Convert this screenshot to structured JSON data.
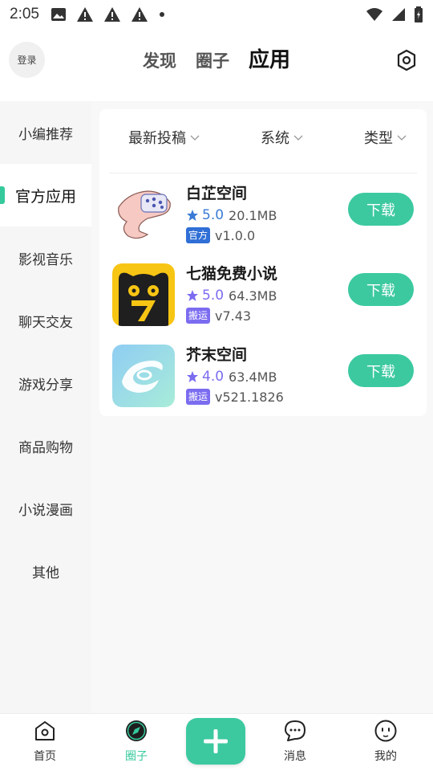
{
  "status_bar": {
    "time": "2:05",
    "left_icons": [
      "image-icon",
      "warning-icon",
      "warning-icon",
      "warning-icon",
      "dot-icon"
    ],
    "right_icons": [
      "wifi-icon",
      "signal-icon",
      "battery-icon"
    ]
  },
  "header": {
    "login_label": "登录",
    "tabs": [
      {
        "label": "发现",
        "active": false
      },
      {
        "label": "圈子",
        "active": false
      },
      {
        "label": "应用",
        "active": true
      }
    ],
    "settings_icon": "settings-icon"
  },
  "sidebar": {
    "items": [
      {
        "label": "小编推荐",
        "active": false
      },
      {
        "label": "官方应用",
        "active": true
      },
      {
        "label": "影视音乐",
        "active": false
      },
      {
        "label": "聊天交友",
        "active": false
      },
      {
        "label": "游戏分享",
        "active": false
      },
      {
        "label": "商品购物",
        "active": false
      },
      {
        "label": "小说漫画",
        "active": false
      },
      {
        "label": "其他",
        "active": false
      }
    ]
  },
  "filters": [
    {
      "label": "最新投稿"
    },
    {
      "label": "系统"
    },
    {
      "label": "类型"
    }
  ],
  "apps": [
    {
      "name": "白芷空间",
      "rating": "5.0",
      "rating_color": "#3a7bd5",
      "size": "20.1MB",
      "badge": "官方",
      "badge_color": "#2f6fd6",
      "version": "v1.0.0",
      "download_label": "下载"
    },
    {
      "name": "七猫免费小说",
      "rating": "5.0",
      "rating_color": "#7b6cf0",
      "size": "64.3MB",
      "badge": "搬运",
      "badge_color": "#7b6cf0",
      "version": "v7.43",
      "download_label": "下载"
    },
    {
      "name": "芥末空间",
      "rating": "4.0",
      "rating_color": "#7b6cf0",
      "size": "63.4MB",
      "badge": "搬运",
      "badge_color": "#7b6cf0",
      "version": "v521.1826",
      "download_label": "下载"
    }
  ],
  "bottom_nav": {
    "items": [
      {
        "label": "首页",
        "icon": "home-icon",
        "active": false
      },
      {
        "label": "圈子",
        "icon": "compass-icon",
        "active": true
      },
      {
        "label": "消息",
        "icon": "chat-icon",
        "active": false
      },
      {
        "label": "我的",
        "icon": "profile-icon",
        "active": false
      }
    ],
    "add_icon": "plus-icon"
  },
  "colors": {
    "accent": "#3cc9a0",
    "sidebar_bg": "#f6f6f6"
  }
}
